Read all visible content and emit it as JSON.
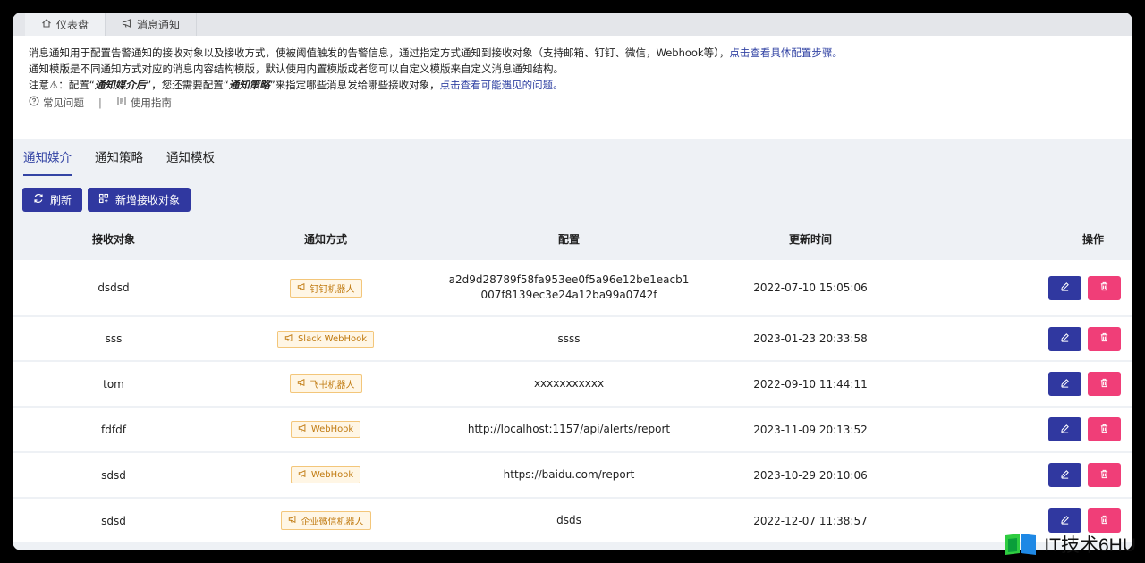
{
  "tabs": [
    {
      "label": "仪表盘",
      "icon": "home-icon"
    },
    {
      "label": "消息通知",
      "icon": "megaphone-icon"
    }
  ],
  "notice": {
    "line1": "消息通知用于配置告警通知的接收对象以及接收方式，使被阈值触发的告警信息，通过指定方式通知到接收对象（支持邮箱、钉钉、微信，Webhook等），",
    "line1_link": "点击查看具体配置步骤。",
    "line2": "通知模版是不同通知方式对应的消息内容结构模版，默认使用内置模版或者您可以自定义模版来自定义消息通知结构。",
    "line3_a": "注意⚠：配置“",
    "line3_em1": "通知媒介后",
    "line3_b": "”，您还需要配置“",
    "line3_em2": "通知策略",
    "line3_c": "”来指定哪些消息发给哪些接收对象，",
    "line3_link": "点击查看可能遇见的问题。",
    "faq": "常见问题",
    "separator": "|",
    "guide": "使用指南"
  },
  "subtabs": [
    "通知媒介",
    "通知策略",
    "通知模板"
  ],
  "toolbar": {
    "refresh": "刷新",
    "add": "新增接收对象"
  },
  "table": {
    "headers": [
      "接收对象",
      "通知方式",
      "配置",
      "更新时间",
      "操作"
    ],
    "rows": [
      {
        "receiver": "dsdsd",
        "method": "钉钉机器人",
        "config1": "a2d9d28789f58fa953ee0f5a96e12be1eacb1",
        "config2": "007f8139ec3e24a12ba99a0742f",
        "time": "2022-07-10 15:05:06"
      },
      {
        "receiver": "sss",
        "method": "Slack WebHook",
        "config1": "ssss",
        "config2": "",
        "time": "2023-01-23 20:33:58"
      },
      {
        "receiver": "tom",
        "method": "飞书机器人",
        "config1": "xxxxxxxxxxx",
        "config2": "",
        "time": "2022-09-10 11:44:11"
      },
      {
        "receiver": "fdfdf",
        "method": "WebHook",
        "config1": "http://localhost:1157/api/alerts/report",
        "config2": "",
        "time": "2023-11-09 20:13:52"
      },
      {
        "receiver": "sdsd",
        "method": "WebHook",
        "config1": "https://baidu.com/report",
        "config2": "",
        "time": "2023-10-29 20:10:06"
      },
      {
        "receiver": "sdsd",
        "method": "企业微信机器人",
        "config1": "dsds",
        "config2": "",
        "time": "2022-12-07 11:38:57"
      }
    ]
  },
  "watermark": "IT技术6HU",
  "colors": {
    "primary": "#3038a0",
    "danger": "#f03e78",
    "badge_text": "#c07a10"
  }
}
